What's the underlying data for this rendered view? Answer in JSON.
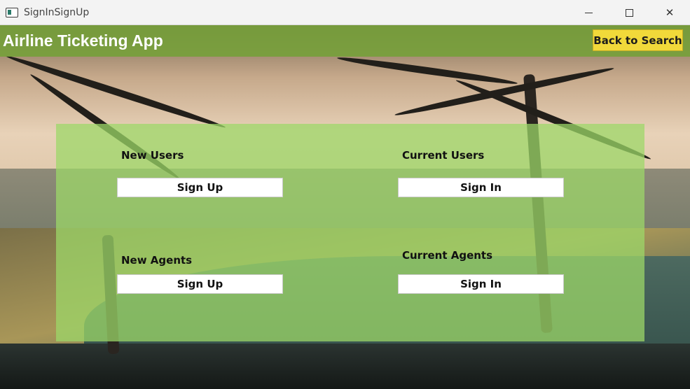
{
  "window": {
    "title": "SignInSignUp",
    "controls": {
      "minimize": "minimize-icon",
      "maximize": "maximize-icon",
      "close": "✕"
    }
  },
  "header": {
    "title": "Airline Ticketing App",
    "back_button": "Back to Search",
    "color": "#76a03a"
  },
  "panel": {
    "color": "#9cd868",
    "new_users": {
      "label": "New Users",
      "button": "Sign Up"
    },
    "current_users": {
      "label": "Current Users",
      "button": "Sign In"
    },
    "new_agents": {
      "label": "New Agents",
      "button": "Sign Up"
    },
    "current_agents": {
      "label": "Current Agents",
      "button": "Sign In"
    }
  },
  "accent": {
    "button_yellow": "#f1d93a"
  }
}
